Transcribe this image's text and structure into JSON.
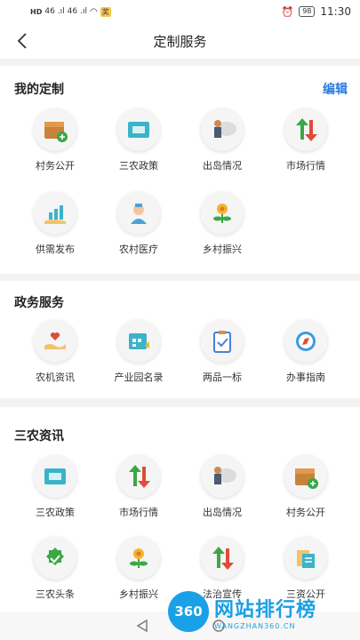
{
  "status": {
    "network": "HD",
    "signal1": "46",
    "signal2": "46",
    "carrier_badge": "奖",
    "alarm_icon": "alarm-icon",
    "battery": "98",
    "time": "11:30"
  },
  "header": {
    "title": "定制服务"
  },
  "my_custom": {
    "title": "我的定制",
    "edit_label": "编辑",
    "items": [
      {
        "label": "村务公开",
        "icon": "box-add-icon"
      },
      {
        "label": "三农政策",
        "icon": "folder-icon"
      },
      {
        "label": "出岛情况",
        "icon": "person-cloud-icon"
      },
      {
        "label": "市场行情",
        "icon": "updown-arrows-icon"
      },
      {
        "label": "供需发布",
        "icon": "growth-hand-icon"
      },
      {
        "label": "农村医疗",
        "icon": "doctor-icon"
      },
      {
        "label": "乡村振兴",
        "icon": "flower-icon"
      }
    ]
  },
  "gov_services": {
    "title": "政务服务",
    "items": [
      {
        "label": "农机资讯",
        "icon": "hand-heart-icon"
      },
      {
        "label": "产业园名录",
        "icon": "calendar-icon"
      },
      {
        "label": "两品一标",
        "icon": "clipboard-check-icon"
      },
      {
        "label": "办事指南",
        "icon": "compass-icon"
      }
    ]
  },
  "news": {
    "title": "三农资讯",
    "items": [
      {
        "label": "三农政策",
        "icon": "folder-icon"
      },
      {
        "label": "市场行情",
        "icon": "updown-arrows-icon"
      },
      {
        "label": "出岛情况",
        "icon": "person-cloud-icon"
      },
      {
        "label": "村务公开",
        "icon": "box-add-icon"
      },
      {
        "label": "三农头条",
        "icon": "badge-check-icon"
      },
      {
        "label": "乡村振兴",
        "icon": "flower-icon"
      },
      {
        "label": "法治宣传",
        "icon": "updown-arrows-icon"
      },
      {
        "label": "三资公开",
        "icon": "docs-icon"
      }
    ]
  },
  "watermark": {
    "logo": "360",
    "text": "网站排行榜",
    "sub": "WANGZHAN360.CN"
  },
  "colors": {
    "accent": "#2b7be0",
    "green": "#3aa845",
    "red": "#e04b3a",
    "orange": "#d98a3a",
    "teal": "#3bb3c9"
  }
}
